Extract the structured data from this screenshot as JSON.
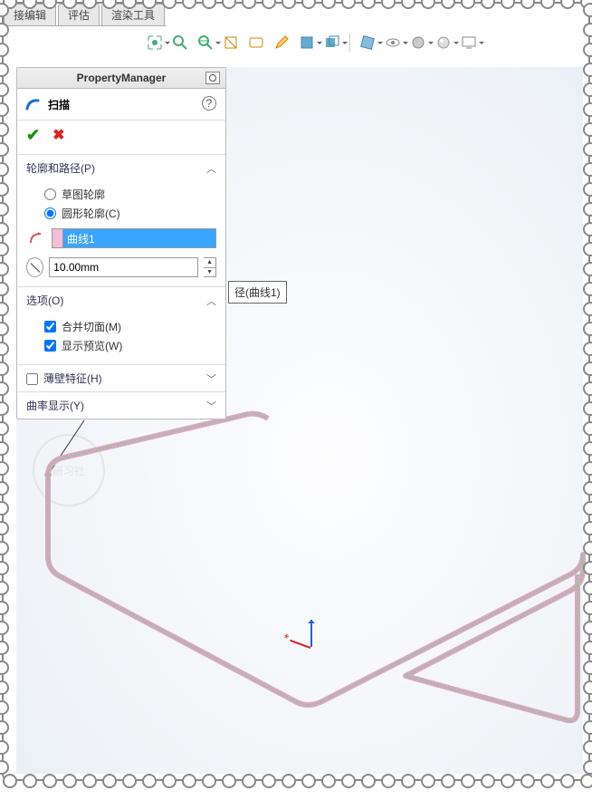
{
  "tabs": [
    "接编辑",
    "评估",
    "渲染工具"
  ],
  "property_manager": {
    "header": "PropertyManager",
    "feature_name": "扫描",
    "help": "?",
    "sections": {
      "profile_path": {
        "title": "轮廓和路径(P)",
        "radios": [
          {
            "label": "草图轮廓",
            "checked": false
          },
          {
            "label": "圆形轮廓(C)",
            "checked": true
          }
        ],
        "path_selection": "曲线1",
        "diameter": "10.00mm"
      },
      "options": {
        "title": "选项(O)",
        "checks": [
          {
            "label": "合并切面(M)",
            "checked": true
          },
          {
            "label": "显示预览(W)",
            "checked": true
          }
        ]
      },
      "thin": {
        "title": "薄壁特征(H)",
        "checked": false
      },
      "curvature": {
        "title": "曲率显示(Y)"
      }
    }
  },
  "tooltip": "径(曲线1)",
  "watermark": "研习社",
  "colors": {
    "accent": "#3aa5ff",
    "pink": "#f4bcd6",
    "ok": "#1a8f1a",
    "cancel": "#d22"
  }
}
